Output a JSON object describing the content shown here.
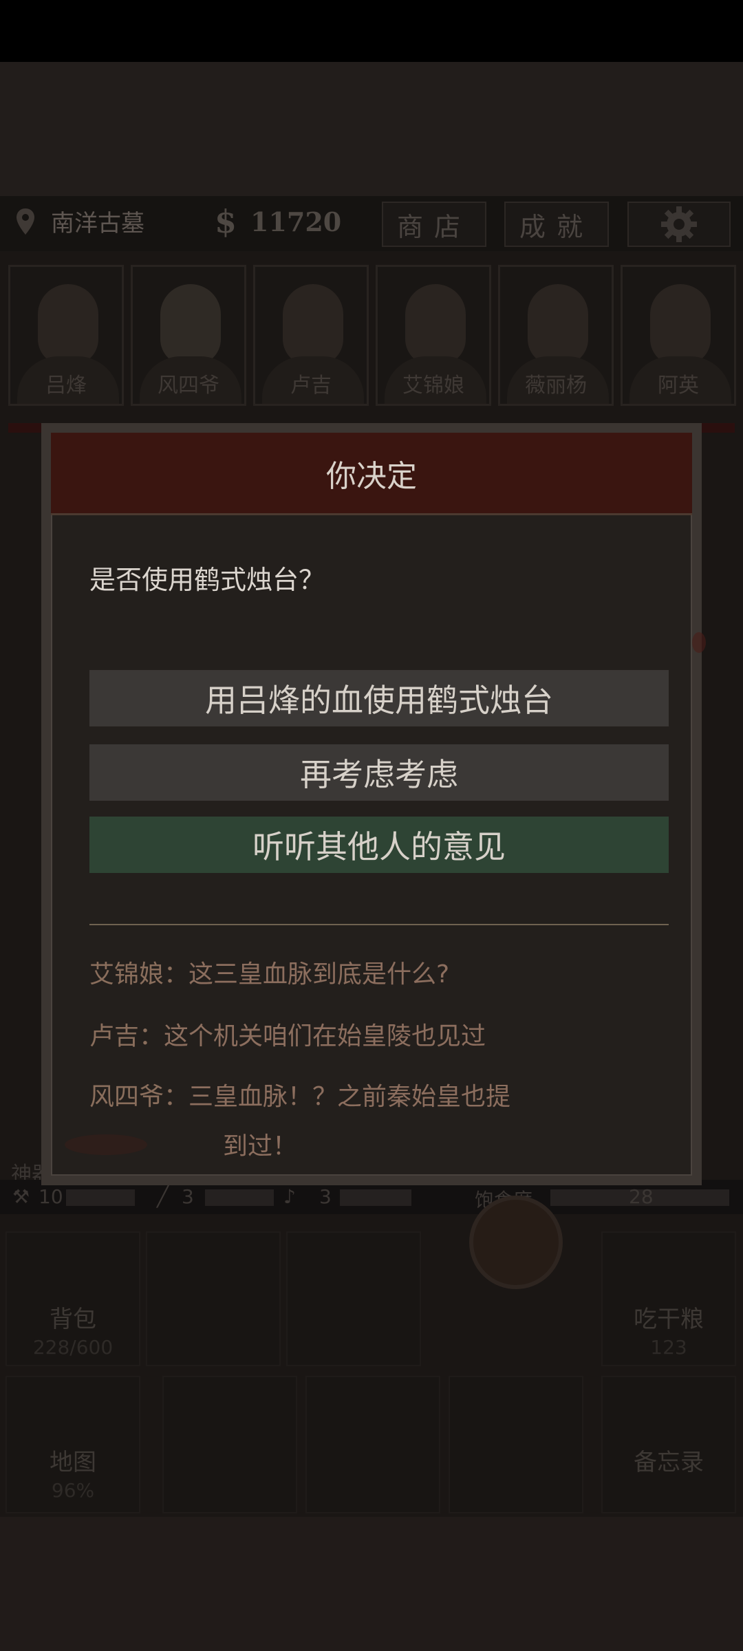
{
  "hud": {
    "location": "南洋古墓",
    "money_symbol": "$",
    "money": "11720",
    "shop_label": "商店",
    "achievements_label": "成就"
  },
  "characters": [
    {
      "name": "吕烽"
    },
    {
      "name": "风四爷"
    },
    {
      "name": "卢吉"
    },
    {
      "name": "艾锦娘"
    },
    {
      "name": "薇丽杨"
    },
    {
      "name": "阿英"
    }
  ],
  "dialog": {
    "title": "你决定",
    "question": "是否使用鹤式烛台？",
    "options": [
      {
        "label": "用吕烽的血使用鹤式烛台"
      },
      {
        "label": "再考虑考虑"
      },
      {
        "label": "听听其他人的意见"
      }
    ],
    "comments": [
      {
        "speaker": "艾锦娘：",
        "text": "这三皇血脉到底是什么?"
      },
      {
        "speaker": "卢吉：",
        "text": "这个机关咱们在始皇陵也见过"
      },
      {
        "speaker": "风四爷：",
        "text": "三皇血脉！？之前秦始皇也提",
        "cont": "到过！"
      }
    ]
  },
  "side_label": "神器",
  "stats": {
    "tool1": "10",
    "tool2": "3",
    "tool3": "3",
    "hunger_label": "饱食度",
    "hunger": "28"
  },
  "tiles": {
    "bag_label": "背包",
    "bag_count": "228/600",
    "eat_label": "吃干粮",
    "eat_count": "123",
    "map_label": "地图",
    "map_pct": "96%",
    "memo_label": "备忘录"
  },
  "colors": {
    "dialog_title_bg": "#3a1510",
    "option_bg": "#3b3836",
    "option_highlight_bg": "#2e4434",
    "chat_text": "#8a6e5c"
  }
}
